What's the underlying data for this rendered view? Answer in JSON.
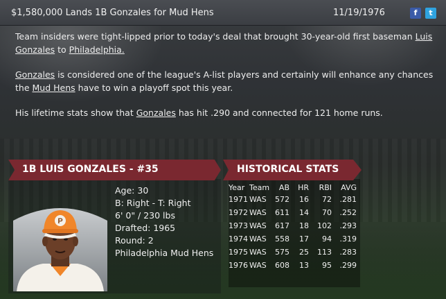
{
  "header": {
    "headline": "$1,580,000 Lands 1B Gonzales for Mud Hens",
    "date": "11/19/1976",
    "facebook_icon": "f",
    "twitter_icon": "t"
  },
  "story": {
    "p1_before": "Team insiders were tight-lipped prior to today's deal that brought 30-year-old first baseman ",
    "p1_link_player": "Luis Gonzales",
    "p1_mid": " to ",
    "p1_link_team": "Philadelphia.",
    "p2_link_player": "Gonzales",
    "p2_mid": " is considered one of the league's A-list players and certainly will enhance any chances the ",
    "p2_link_team": "Mud Hens",
    "p2_after": " have to win a playoff spot this year.",
    "p3_before": "His lifetime stats show that ",
    "p3_link_player": "Gonzales",
    "p3_after": " has hit .290 and connected for 121 home runs."
  },
  "player": {
    "banner": "1B LUIS GONZALES - #35",
    "age": "Age: 30",
    "bats_throws": "B: Right - T: Right",
    "height_weight": "6' 0\" / 230 lbs",
    "drafted": "Drafted: 1965",
    "round": "Round: 2",
    "team": "Philadelphia Mud Hens",
    "cap_letter": "P",
    "colors": {
      "cap": "#f0862a",
      "banner": "#7a2830"
    }
  },
  "stats": {
    "banner": "HISTORICAL STATS",
    "headers": [
      "Year",
      "Team",
      "AB",
      "HR",
      "RBI",
      "AVG"
    ],
    "rows": [
      [
        "1971",
        "WAS",
        "572",
        "16",
        "72",
        ".281"
      ],
      [
        "1972",
        "WAS",
        "611",
        "14",
        "70",
        ".252"
      ],
      [
        "1973",
        "WAS",
        "617",
        "18",
        "102",
        ".293"
      ],
      [
        "1974",
        "WAS",
        "558",
        "17",
        "94",
        ".319"
      ],
      [
        "1975",
        "WAS",
        "575",
        "25",
        "113",
        ".283"
      ],
      [
        "1976",
        "WAS",
        "608",
        "13",
        "95",
        ".299"
      ]
    ]
  }
}
